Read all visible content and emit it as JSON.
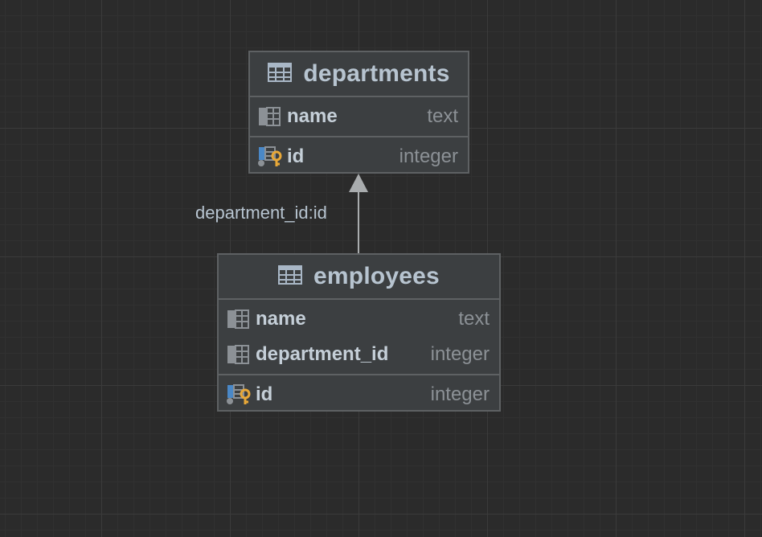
{
  "relationship": {
    "label": "department_id:id",
    "from": "employees",
    "to": "departments"
  },
  "entities": {
    "departments": {
      "title": "departments",
      "columns": [
        {
          "name": "name",
          "type": "text",
          "icon": "column-icon"
        },
        {
          "name": "id",
          "type": "integer",
          "icon": "primary-key-icon"
        }
      ]
    },
    "employees": {
      "title": "employees",
      "columns": [
        {
          "name": "name",
          "type": "text",
          "icon": "column-icon"
        },
        {
          "name": "department_id",
          "type": "integer",
          "icon": "column-icon"
        },
        {
          "name": "id",
          "type": "integer",
          "icon": "primary-key-icon"
        }
      ]
    }
  },
  "colors": {
    "background": "#2b2b2b",
    "entity_fill": "#3c3f41",
    "entity_border": "#5e6163",
    "title_text": "#b7c4d0",
    "type_text": "#8c9196",
    "key_accent": "#e8a838",
    "connector": "#a9acae"
  }
}
